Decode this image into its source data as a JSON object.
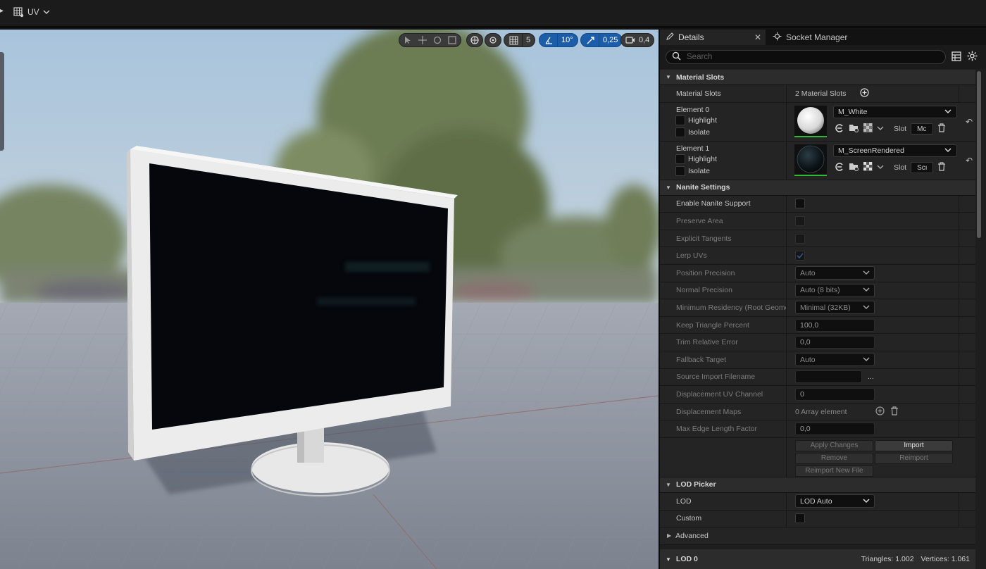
{
  "toolbar": {
    "view_mode": "UV"
  },
  "viewport": {
    "transform_tools": [
      "select",
      "translate",
      "rotate",
      "scale"
    ],
    "grid_snap": "5",
    "rotation_snap": "10°",
    "scale_snap": "0,25",
    "camera_speed": "0,4"
  },
  "panel": {
    "tabs": [
      {
        "label": "Details",
        "active": true
      },
      {
        "label": "Socket Manager",
        "active": false
      }
    ],
    "search_placeholder": "Search",
    "material_slots": {
      "title": "Material Slots",
      "label": "Material Slots",
      "count_text": "2 Material Slots",
      "elements": [
        {
          "name": "Element 0",
          "highlight": "Highlight",
          "isolate": "Isolate",
          "material": "M_White",
          "slot_label": "Slot",
          "slot_value": "Mc"
        },
        {
          "name": "Element 1",
          "highlight": "Highlight",
          "isolate": "Isolate",
          "material": "M_ScreenRendered",
          "slot_label": "Slot",
          "slot_value": "Scı"
        }
      ]
    },
    "nanite": {
      "title": "Nanite Settings",
      "enable_label": "Enable Nanite Support",
      "preserve_area": "Preserve Area",
      "explicit_tangents": "Explicit Tangents",
      "lerp_uvs": "Lerp UVs",
      "position_precision": {
        "label": "Position Precision",
        "value": "Auto"
      },
      "normal_precision": {
        "label": "Normal Precision",
        "value": "Auto (8 bits)"
      },
      "min_residency": {
        "label": "Minimum Residency (Root Geome",
        "value": "Minimal (32KB)"
      },
      "keep_triangle": {
        "label": "Keep Triangle Percent",
        "value": "100,0"
      },
      "trim_error": {
        "label": "Trim Relative Error",
        "value": "0,0"
      },
      "fallback_target": {
        "label": "Fallback Target",
        "value": "Auto"
      },
      "source_import": {
        "label": "Source Import Filename",
        "value": "",
        "more": "..."
      },
      "displacement_uv": {
        "label": "Displacement UV Channel",
        "value": "0"
      },
      "displacement_maps": {
        "label": "Displacement Maps",
        "value": "0 Array element"
      },
      "max_edge": {
        "label": "Max Edge Length Factor",
        "value": "0,0"
      },
      "buttons": [
        "Apply Changes",
        "Import",
        "Remove",
        "Reimport",
        "Reimport New File"
      ]
    },
    "lod_picker": {
      "title": "LOD Picker",
      "lod_label": "LOD",
      "lod_value": "LOD Auto",
      "custom_label": "Custom",
      "advanced_label": "Advanced"
    },
    "lod0": {
      "title": "LOD 0",
      "triangles": "Triangles: 1.002",
      "vertices": "Vertices: 1.061"
    }
  }
}
